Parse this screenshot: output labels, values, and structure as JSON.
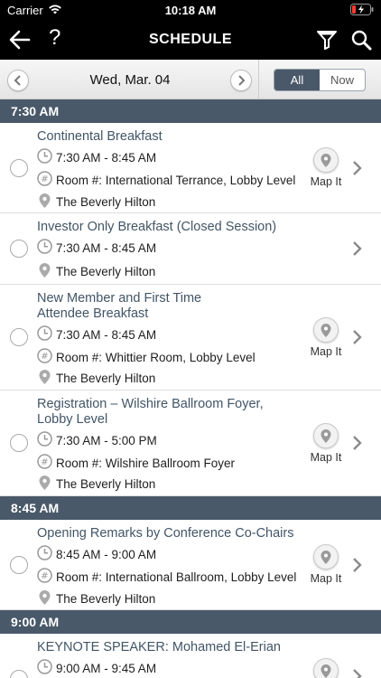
{
  "status": {
    "carrier": "Carrier",
    "time": "10:18 AM"
  },
  "nav": {
    "title": "SCHEDULE"
  },
  "date_bar": {
    "date": "Wed, Mar. 04",
    "seg_all": "All",
    "seg_now": "Now"
  },
  "sections": [
    {
      "time": "7:30 AM"
    },
    {
      "time": "8:45 AM"
    },
    {
      "time": "9:00 AM"
    }
  ],
  "rows": [
    {
      "title": "Continental Breakfast",
      "time": "7:30 AM - 8:45 AM",
      "room": "Room #: International Terrance, Lobby Level",
      "venue": "The Beverly Hilton",
      "map_label": "Map It"
    },
    {
      "title": "Investor Only Breakfast (Closed Session)",
      "time": "7:30 AM - 8:45 AM",
      "venue": "The Beverly Hilton"
    },
    {
      "title_line1": "New Member and First Time",
      "title_line2": "Attendee Breakfast",
      "time": "7:30 AM - 8:45 AM",
      "room": "Room #: Whittier Room, Lobby Level",
      "venue": "The Beverly Hilton",
      "map_label": "Map It"
    },
    {
      "title_line1": "Registration – Wilshire Ballroom Foyer,",
      "title_line2": "Lobby Level",
      "time": "7:30 AM - 5:00 PM",
      "room": "Room #: Wilshire Ballroom Foyer",
      "venue": "The Beverly Hilton",
      "map_label": "Map It"
    },
    {
      "title": "Opening Remarks by Conference Co-Chairs",
      "time": "8:45 AM - 9:00 AM",
      "room": "Room #: International Ballroom, Lobby Level",
      "venue": "The Beverly Hilton",
      "map_label": "Map It"
    },
    {
      "title": "KEYNOTE SPEAKER: Mohamed El-Erian",
      "time": "9:00 AM - 9:45 AM"
    }
  ]
}
